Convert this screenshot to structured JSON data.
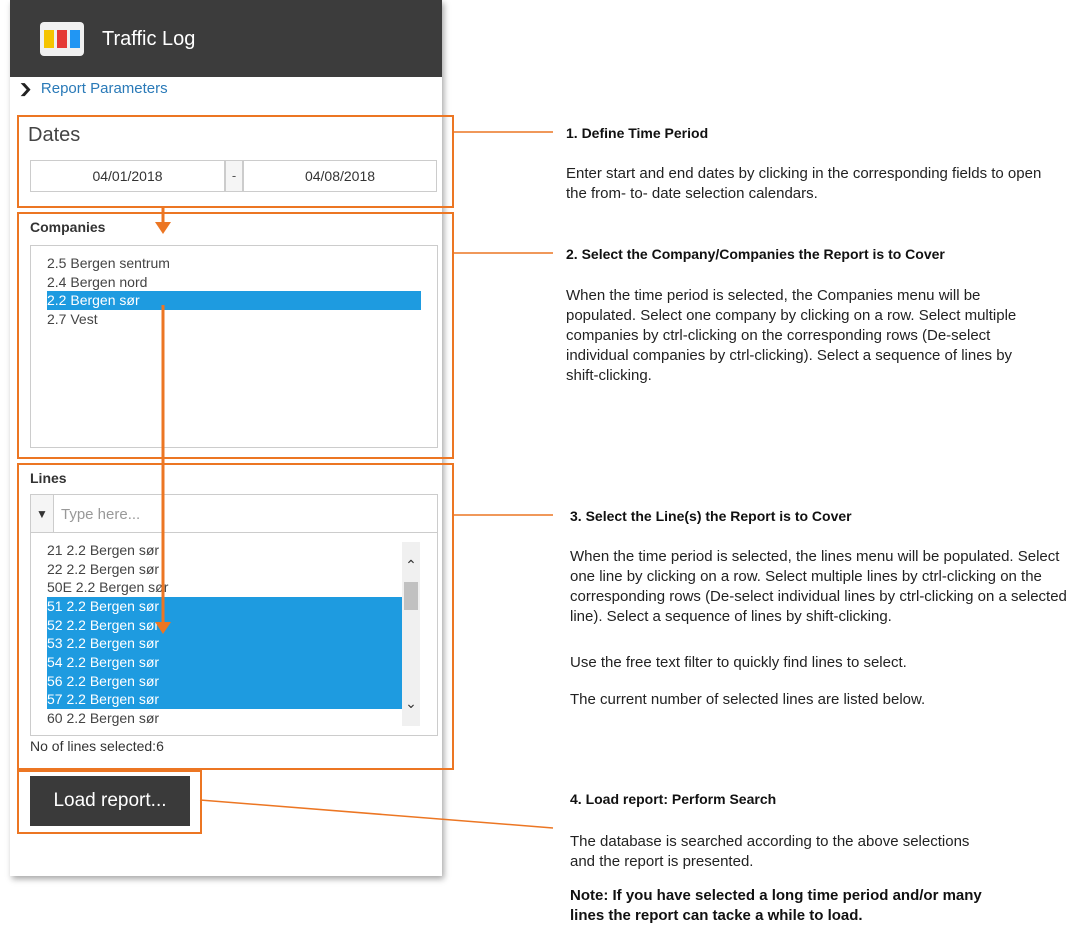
{
  "app": {
    "title": "Traffic Log"
  },
  "report_parameters": {
    "label": "Report Parameters"
  },
  "dates": {
    "title": "Dates",
    "from": "04/01/2018",
    "separator": "-",
    "to": "04/08/2018"
  },
  "companies": {
    "title": "Companies",
    "items": [
      {
        "label": "2.5 Bergen sentrum",
        "selected": false
      },
      {
        "label": "2.4 Bergen nord",
        "selected": false
      },
      {
        "label": "2.2 Bergen sør",
        "selected": true
      },
      {
        "label": "2.7 Vest",
        "selected": false
      }
    ]
  },
  "lines": {
    "title": "Lines",
    "filter_placeholder": "Type here...",
    "items": [
      {
        "label": "21 2.2 Bergen sør",
        "selected": false
      },
      {
        "label": "22 2.2 Bergen sør",
        "selected": false
      },
      {
        "label": "50E 2.2 Bergen sør",
        "selected": false
      },
      {
        "label": "51 2.2 Bergen sør",
        "selected": true
      },
      {
        "label": "52 2.2 Bergen sør",
        "selected": true
      },
      {
        "label": "53 2.2 Bergen sør",
        "selected": true
      },
      {
        "label": "54 2.2 Bergen sør",
        "selected": true
      },
      {
        "label": "56 2.2 Bergen sør",
        "selected": true
      },
      {
        "label": "57 2.2 Bergen sør",
        "selected": true
      },
      {
        "label": "60 2.2 Bergen sør",
        "selected": false
      }
    ],
    "count_label": "No of lines selected:6"
  },
  "load_button": {
    "label": "Load report..."
  },
  "annotations": {
    "a1": {
      "title": "1. Define Time Period",
      "text": "Enter start and end dates by clicking in the corresponding fields to open the from- to- date selection calendars."
    },
    "a2": {
      "title": "2. Select the Company/Companies the Report is to Cover",
      "text": "When the time period is selected, the Companies menu will be populated. Select one company by clicking on a row. Select multiple companies by ctrl-clicking on the corresponding rows (De-select individual companies by ctrl-clicking). Select a sequence of lines by shift-clicking."
    },
    "a3": {
      "title": "3. Select the Line(s) the Report is to Cover",
      "text": "When the time period is selected, the lines menu will be populated. Select one line by clicking on a row. Select multiple lines by ctrl-clicking on the corresponding rows (De-select individual lines by ctrl-clicking on a selected line). Select a sequence of lines by shift-clicking.",
      "text2": "Use the free text filter to quickly find lines to select.",
      "text3": "The current number of selected lines are listed below."
    },
    "a4": {
      "title": "4. Load report: Perform Search",
      "text": "The database is searched according to the above selections and the report is presented.",
      "note": "Note: If you have selected a long time period and/or many lines the report can tacke a while to load."
    }
  },
  "colors": {
    "accent_orange": "#ec7623",
    "selection_blue": "#1e9be0",
    "appbar": "#3c3c3c"
  }
}
